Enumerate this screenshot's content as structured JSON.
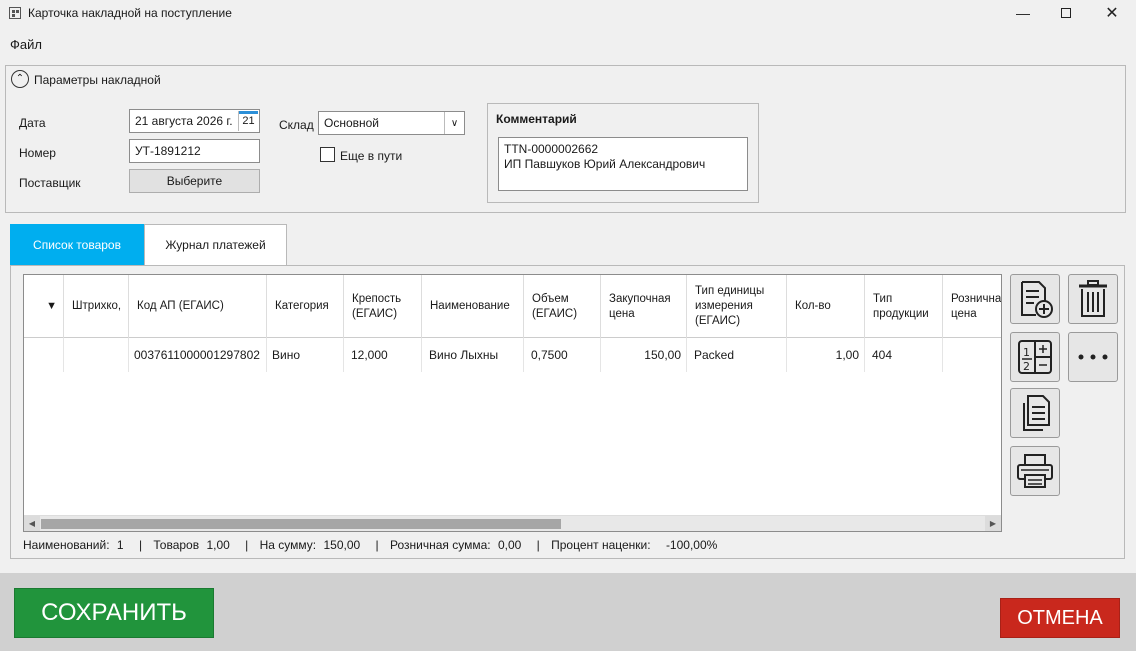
{
  "window": {
    "title": "Карточка накладной на поступление"
  },
  "menu": {
    "file": "Файл"
  },
  "params": {
    "title": "Параметры накладной",
    "date_label": "Дата",
    "date_value": "21 августа 2026 г.",
    "calendar_day": "21",
    "number_label": "Номер",
    "number_value": "УТ-1891212",
    "supplier_label": "Поставщик",
    "supplier_button": "Выберите",
    "warehouse_label": "Склад",
    "warehouse_value": "Основной",
    "in_transit_label": "Еще в пути",
    "comment_title": "Комментарий",
    "comment_line1": "TTN-0000002662",
    "comment_line2": "ИП Павшуков Юрий Александрович"
  },
  "tabs": [
    {
      "label": "Список товаров",
      "active": true
    },
    {
      "label": "Журнал платежей",
      "active": false
    }
  ],
  "table": {
    "sort_glyph": "▼",
    "headers": [
      "Штрихко,",
      "Код АП (ЕГАИС)",
      "Категория",
      "Крепость (ЕГАИС)",
      "Наименование",
      "Объем (ЕГАИС)",
      "Закупочная цена",
      "Тип единицы измерения (ЕГАИС)",
      "Кол-во",
      "Тип продукции",
      "Розничная цена"
    ],
    "rows": [
      [
        "",
        "0037611000001297802",
        "Вино",
        "12,000",
        "Вино Лыхны",
        "0,7500",
        "150,00",
        "Packed",
        "1,00",
        "404",
        ""
      ]
    ]
  },
  "status": {
    "names_label": "Наименований:",
    "names_value": "1",
    "items_label": "Товаров",
    "items_value": "1,00",
    "sum_label": "На сумму:",
    "sum_value": "150,00",
    "retail_label": "Розничная сумма:",
    "retail_value": "0,00",
    "markup_label": "Процент наценки:",
    "markup_value": "-100,00%",
    "separator": "|"
  },
  "footer": {
    "save": "СОХРАНИТЬ",
    "cancel": "ОТМЕНА"
  },
  "colors": {
    "accent": "#00aeef",
    "save": "#21943c",
    "cancel": "#c9281d"
  }
}
